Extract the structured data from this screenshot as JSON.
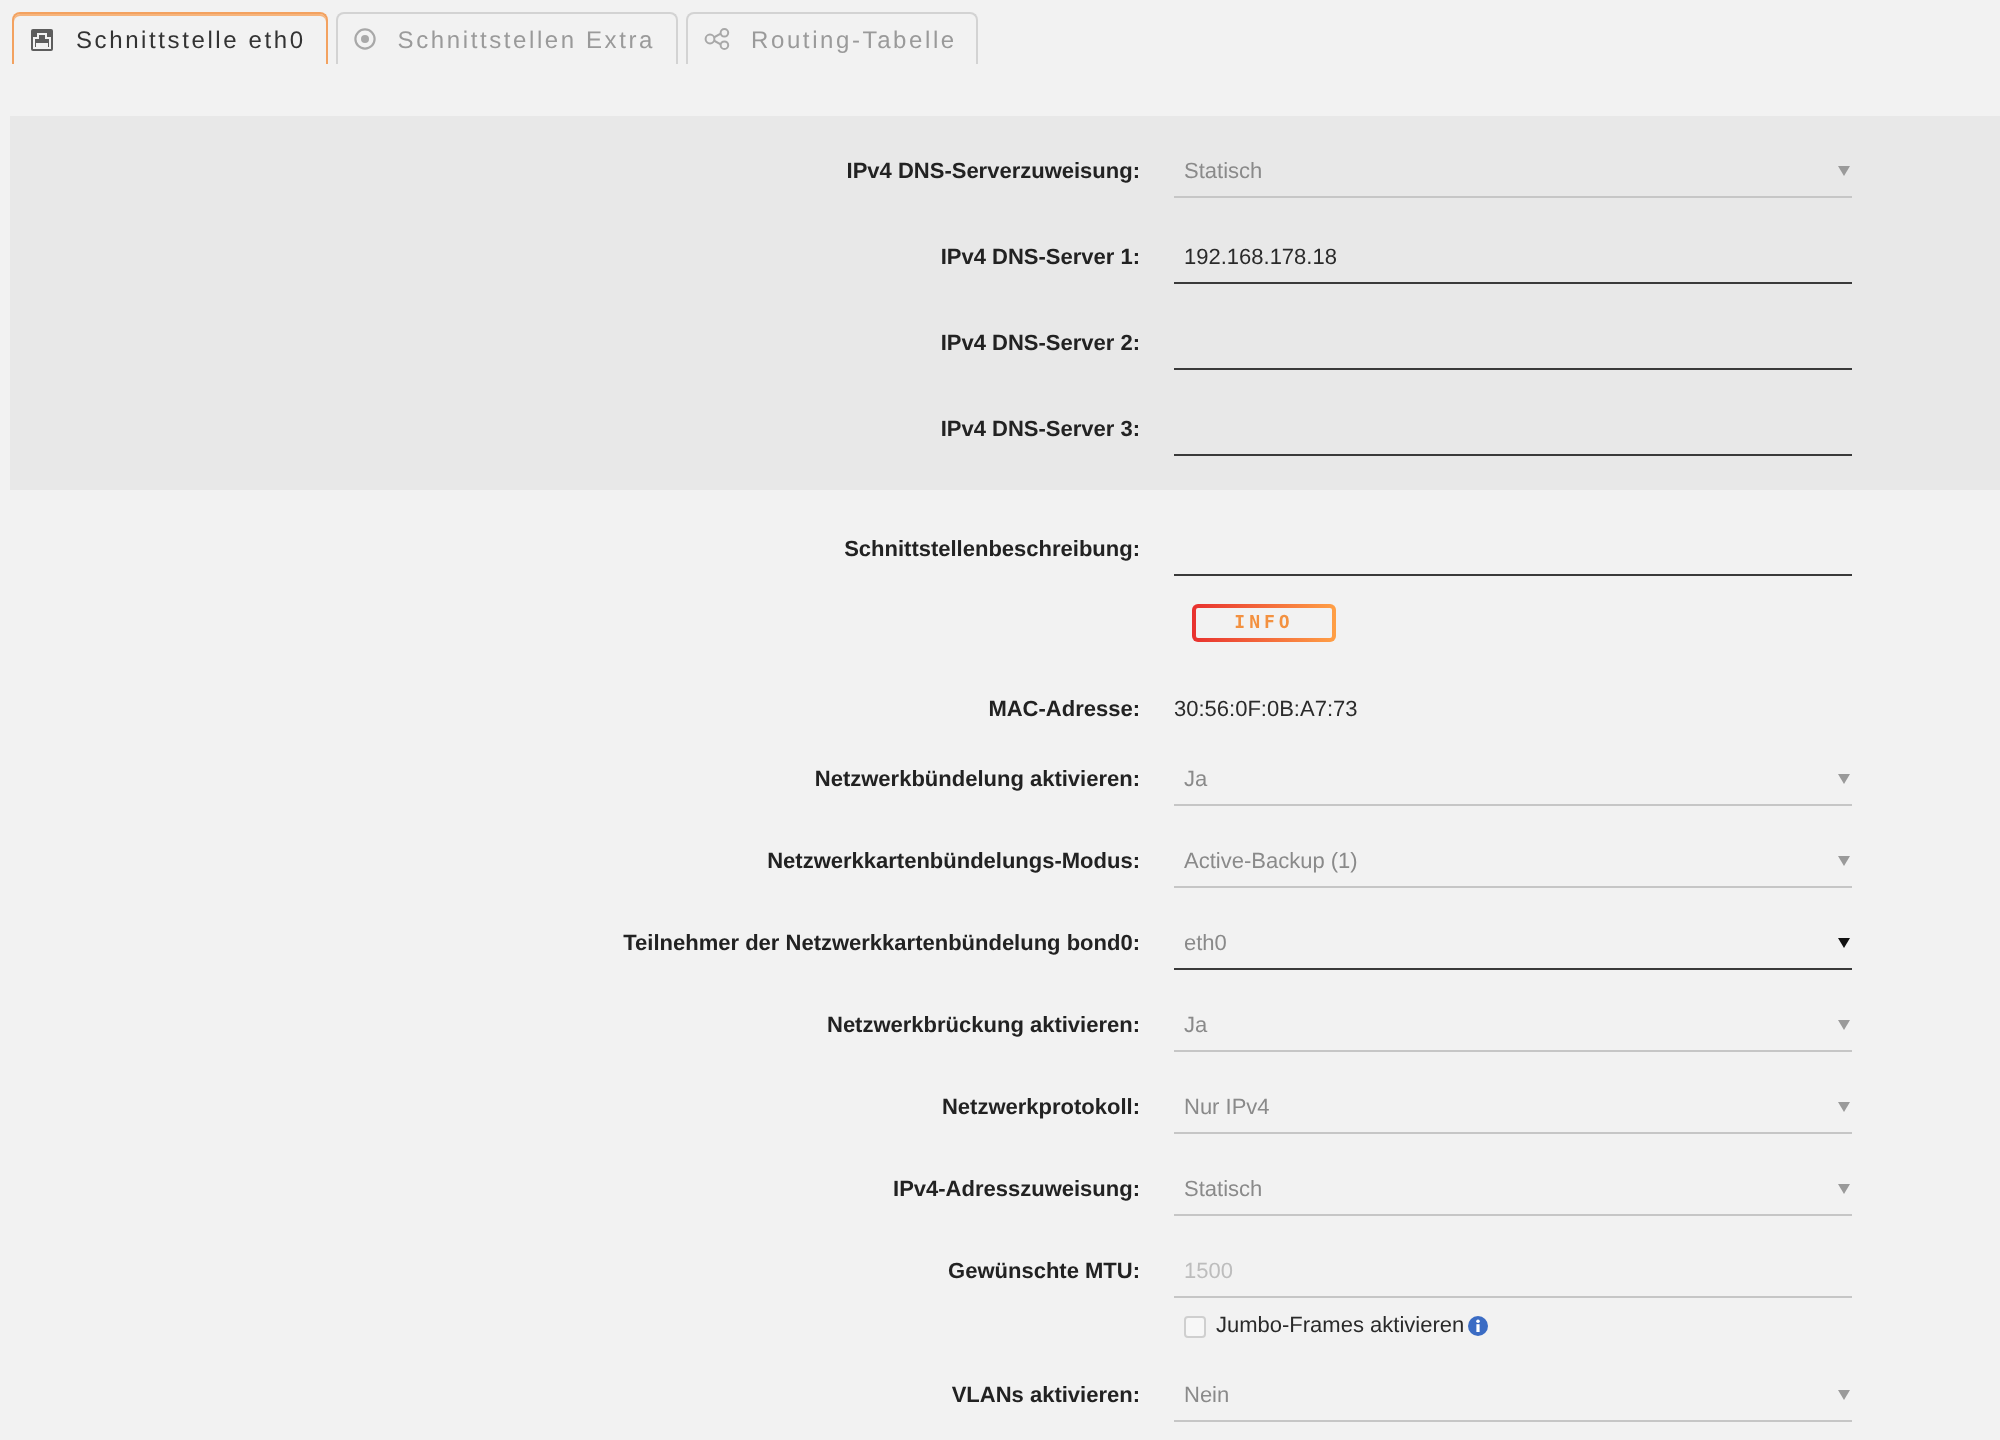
{
  "tabs": [
    {
      "label": "Schnittstelle eth0",
      "selected": true
    },
    {
      "label": "Schnittstellen Extra",
      "selected": false
    },
    {
      "label": "Routing-Tabelle",
      "selected": false
    }
  ],
  "dns_section": {
    "fields": [
      {
        "kind": "select",
        "label": "IPv4 DNS-Serverzuweisung:",
        "value": "Statisch",
        "disabled": true
      },
      {
        "kind": "text",
        "label": "IPv4 DNS-Server 1:",
        "value": "192.168.178.18",
        "disabled": false
      },
      {
        "kind": "text",
        "label": "IPv4 DNS-Server 2:",
        "disabled": false
      },
      {
        "kind": "text",
        "label": "IPv4 DNS-Server 3:",
        "disabled": false
      }
    ]
  },
  "fields": [
    {
      "kind": "text",
      "label": "Schnittstellenbeschreibung:",
      "disabled": false
    },
    {
      "kind": "button",
      "label": "INFO"
    },
    {
      "kind": "static",
      "label": "MAC-Adresse:",
      "value": "30:56:0F:0B:A7:73"
    },
    {
      "kind": "select",
      "label": "Netzwerkbündelung aktivieren:",
      "value": "Ja",
      "disabled": true
    },
    {
      "kind": "select",
      "label": "Netzwerkkartenbündelungs-Modus:",
      "value": "Active-Backup (1)",
      "disabled": true
    },
    {
      "kind": "select",
      "label": "Teilnehmer der Netzwerkkartenbündelung bond0:",
      "value": "eth0",
      "disabled": false
    },
    {
      "kind": "select",
      "label": "Netzwerkbrückung aktivieren:",
      "value": "Ja",
      "disabled": true
    },
    {
      "kind": "select",
      "label": "Netzwerkprotokoll:",
      "value": "Nur IPv4",
      "disabled": true
    },
    {
      "kind": "select",
      "label": "IPv4-Adresszuweisung:",
      "value": "Statisch",
      "disabled": true
    },
    {
      "kind": "text",
      "label": "Gewünschte MTU:",
      "placeholder": "1500",
      "disabled": true
    },
    {
      "kind": "checkbox",
      "label": "Jumbo-Frames aktivieren",
      "checked": false
    },
    {
      "kind": "select",
      "label": "VLANs aktivieren:",
      "value": "Nein",
      "disabled": true
    }
  ]
}
